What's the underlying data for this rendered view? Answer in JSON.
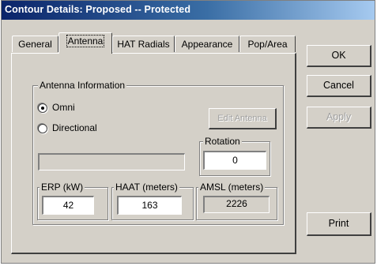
{
  "window": {
    "title": "Contour Details: Proposed -- Protected"
  },
  "tabs": [
    {
      "label": "General"
    },
    {
      "label": "Antenna"
    },
    {
      "label": "HAT Radials"
    },
    {
      "label": "Appearance"
    },
    {
      "label": "Pop/Area"
    }
  ],
  "active_tab": "Antenna",
  "antenna_info": {
    "group_label": "Antenna Information",
    "omni_label": "Omni",
    "directional_label": "Directional",
    "selected": "Omni",
    "edit_antenna_label": "Edit Antenna",
    "pattern_field_value": "",
    "rotation_label": "Rotation",
    "rotation_value": "0"
  },
  "erp": {
    "label": "ERP (kW)",
    "value": "42"
  },
  "haat": {
    "label": "HAAT (meters)",
    "value": "163"
  },
  "amsl": {
    "label": "AMSL (meters)",
    "value": "2226"
  },
  "buttons": {
    "ok": "OK",
    "cancel": "Cancel",
    "apply": "Apply",
    "print": "Print"
  }
}
